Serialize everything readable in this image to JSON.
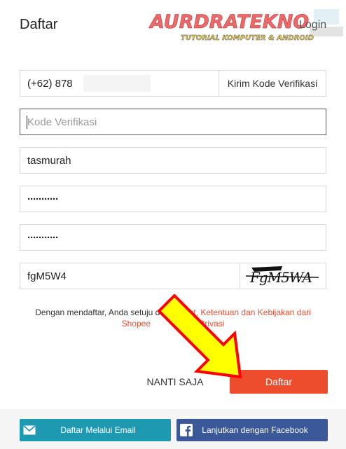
{
  "header": {
    "title": "Daftar",
    "login_label": "Login",
    "watermark_title": "AURDRATEKNO",
    "watermark_subtitle": "TUTORIAL KOMPUTER & ANDROID"
  },
  "form": {
    "phone_value": "(+62) 878",
    "send_code_label": "Kirim Kode Verifikasi",
    "verification_placeholder": "Kode Verifikasi",
    "username_value": "tasmurah",
    "password_value": "···········",
    "confirm_password_value": "···········",
    "captcha_value": "fgM5W4",
    "captcha_image_text": "FgM5WA"
  },
  "terms": {
    "prefix": "Dengan mendaftar, Anda setuju de",
    "link1": "n Syarat, Ketentuan dan Kebijakan dari",
    "link2": "Shopee",
    "middle": " ",
    "link3": "n Privasi"
  },
  "actions": {
    "skip_label": "NANTI SAJA",
    "submit_label": "Daftar"
  },
  "footer": {
    "email_label": "Daftar Melalui Email",
    "facebook_label": "Lanjutkan dengan Facebook"
  },
  "colors": {
    "accent": "#ee4d2d",
    "email_btn": "#1d9ab1",
    "facebook_btn": "#3b5998",
    "arrow_fill": "#ffff00",
    "arrow_stroke": "#ff0000"
  }
}
